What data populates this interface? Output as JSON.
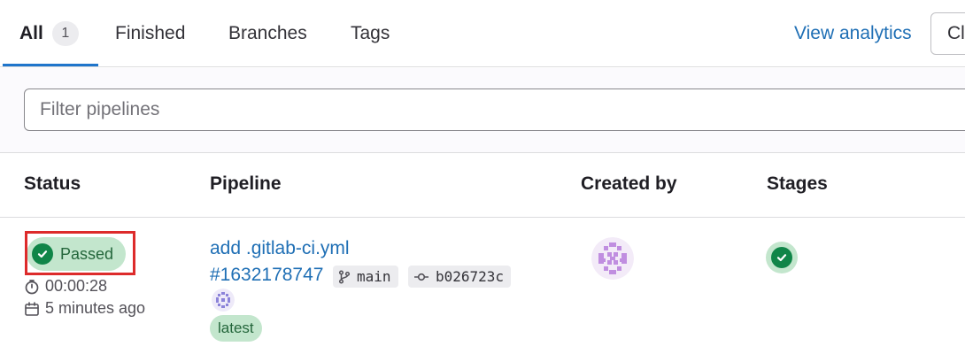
{
  "tabs": [
    {
      "label": "All",
      "count": "1",
      "active": true
    },
    {
      "label": "Finished"
    },
    {
      "label": "Branches"
    },
    {
      "label": "Tags"
    }
  ],
  "header_actions": {
    "analytics_label": "View analytics",
    "clear_label": "Cl"
  },
  "filter": {
    "placeholder": "Filter pipelines"
  },
  "table": {
    "columns": [
      "Status",
      "Pipeline",
      "Created by",
      "Stages"
    ],
    "rows": [
      {
        "status": "Passed",
        "duration": "00:00:28",
        "finished": "5 minutes ago",
        "commit_title": "add .gitlab-ci.yml",
        "pipeline_id": "#1632178747",
        "branch": "main",
        "commit_sha": "b026723c",
        "badge": "latest",
        "stage_status": "passed"
      }
    ]
  },
  "colors": {
    "accent": "#1f75cb",
    "link": "#1f6fb5",
    "success": "#108548",
    "success_bg": "#c3e6cd",
    "highlight": "#dd2b2b"
  },
  "icons": [
    "check-circle-icon",
    "timer-icon",
    "calendar-icon",
    "branch-icon",
    "commit-icon",
    "avatar-identicon"
  ]
}
